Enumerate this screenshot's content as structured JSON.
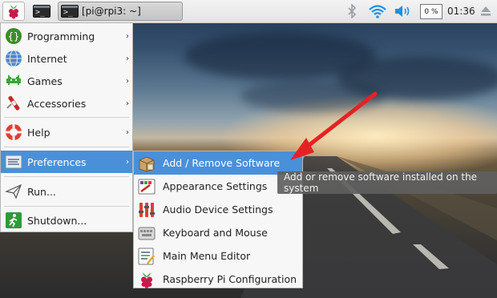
{
  "taskbar": {
    "menu_icon": "raspberry-icon",
    "terminal_icon": "terminal-icon",
    "terminal_glyph": ">_",
    "task_label": "[pi@rpi3: ~]",
    "cpu_usage": "0 %",
    "clock": "01:36",
    "tray_icons": [
      "bluetooth-icon",
      "wifi-icon",
      "volume-icon",
      "eject-icon"
    ]
  },
  "main_menu": {
    "items": [
      {
        "label": "Programming",
        "icon": "programming-icon",
        "submenu": true
      },
      {
        "label": "Internet",
        "icon": "globe-icon",
        "submenu": true
      },
      {
        "label": "Games",
        "icon": "games-icon",
        "submenu": true
      },
      {
        "label": "Accessories",
        "icon": "accessories-icon",
        "submenu": true
      },
      {
        "label": "Help",
        "icon": "help-icon",
        "submenu": true
      },
      {
        "label": "Preferences",
        "icon": "preferences-icon",
        "submenu": true,
        "active": true
      },
      {
        "label": "Run...",
        "icon": "run-icon",
        "submenu": false
      },
      {
        "label": "Shutdown...",
        "icon": "shutdown-icon",
        "submenu": false
      }
    ],
    "arrow_glyph": "›"
  },
  "preferences_submenu": {
    "items": [
      {
        "label": "Add / Remove Software",
        "icon": "package-icon",
        "active": true
      },
      {
        "label": "Appearance Settings",
        "icon": "appearance-icon"
      },
      {
        "label": "Audio Device Settings",
        "icon": "audio-settings-icon"
      },
      {
        "label": "Keyboard and Mouse",
        "icon": "keyboard-mouse-icon"
      },
      {
        "label": "Main Menu Editor",
        "icon": "menu-editor-icon"
      },
      {
        "label": "Raspberry Pi Configuration",
        "icon": "raspberry-icon"
      }
    ]
  },
  "tooltip": {
    "text": "Add or remove software installed on the system"
  },
  "colors": {
    "menu_highlight": "#4a90d9",
    "annotation_arrow": "#e52222",
    "wifi_blue": "#1e90e0"
  }
}
